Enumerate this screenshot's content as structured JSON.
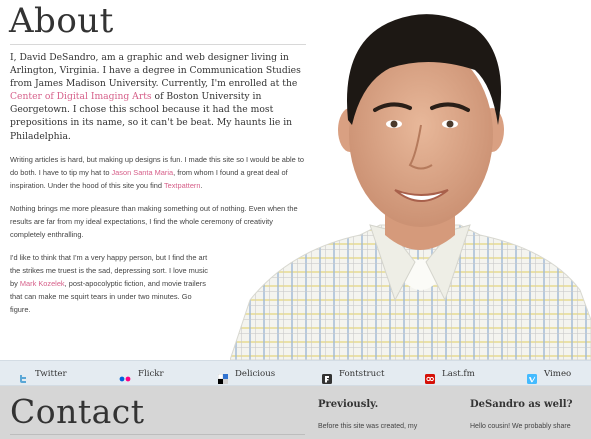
{
  "about": {
    "title": "About",
    "intro_1": "I, David DeSandro, am a graphic and web designer living in Arlington, Virginia. I have a degree in Communication Studies from James Madison University. Currently, I'm enrolled at the ",
    "intro_link": "Center of Digital Imaging Arts",
    "intro_2": " of Boston University in Georgetown. I chose this school because it had the most prepositions in its name, so it can't be beat. My haunts lie in Philadelphia.",
    "p2_1": "Writing articles is hard, but making up designs is fun. I made this site so I would be able to do both. I have to tip my hat to ",
    "p2_link1": "Jason Santa Maria",
    "p2_2": ", from whom I found a great deal of inspiration. Under the hood of this site you find ",
    "p2_link2": "Textpattern",
    "p2_3": ".",
    "p3": "Nothing brings me more pleasure than making something out of nothing. Even when the results are far from my ideal expectations, I find the whole ceremony of creativity completely enthralling.",
    "p4_1": "I'd like to think that I'm a very happy person, but I find the art the strikes me truest is the sad, depressing sort. I love music by ",
    "p4_link": "Mark Kozelek",
    "p4_2": ", post-apocolyptic fiction, and movie trailers that can make me squirt tears in under two minutes. Go figure."
  },
  "social": [
    {
      "label": "Twitter",
      "icon": "twitter-icon",
      "color": "#5aa7d6"
    },
    {
      "label": "Flickr",
      "icon": "flickr-icon",
      "color": "#0063dc"
    },
    {
      "label": "Delicious",
      "icon": "delicious-icon",
      "color": "#3274d1"
    },
    {
      "label": "Fontstruct",
      "icon": "fontstruct-icon",
      "color": "#333333"
    },
    {
      "label": "Last.fm",
      "icon": "lastfm-icon",
      "color": "#d51007"
    },
    {
      "label": "Vimeo",
      "icon": "vimeo-icon",
      "color": "#44bbff"
    }
  ],
  "bottom": {
    "contact_title": "Contact",
    "previously_title": "Previously.",
    "previously_text": "Before this site was created, my",
    "desandro_title": "DeSandro as well?",
    "desandro_text": "Hello cousin! We probably share"
  },
  "colors": {
    "link": "#d6608a",
    "social_bar": "#e4ebf1",
    "bottom_bg": "#d6d6d6"
  }
}
